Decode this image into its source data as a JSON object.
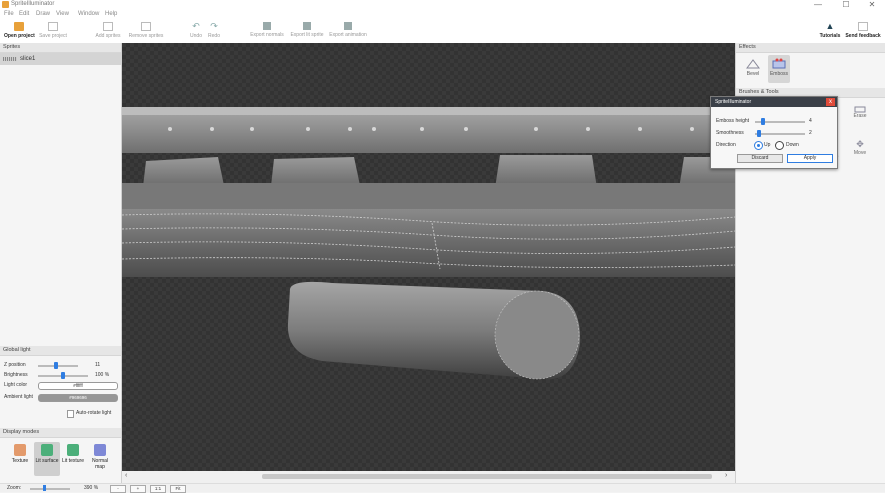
{
  "app": {
    "title": "SpriteIlluminator"
  },
  "window_controls": {
    "minimize": "—",
    "maximize": "☐",
    "close": "✕"
  },
  "menu": [
    "File",
    "Edit",
    "Draw",
    "View",
    "Window",
    "Help"
  ],
  "toolbar": {
    "open_project": "Open project",
    "save_project": "Save project",
    "add_sprites": "Add sprites",
    "remove_sprites": "Remove sprites",
    "undo": "Undo",
    "redo": "Redo",
    "export_normals": "Export normals",
    "export_lit_sprite": "Export lit sprite",
    "export_animation": "Export animation",
    "tutorials": "Tutorials",
    "send_feedback": "Send feedback"
  },
  "sprites_panel": {
    "header": "Sprites",
    "items": [
      {
        "name": "slice1"
      }
    ]
  },
  "global_light": {
    "header": "Global light",
    "z_position_label": "Z position",
    "z_position_value": "11",
    "z_position_level": 0.45,
    "brightness_label": "Brightness",
    "brightness_value": "100 %",
    "brightness_level": 0.5,
    "light_color_label": "Light color",
    "light_color_value": "#ffffff",
    "ambient_light_label": "Ambient light",
    "ambient_light_value": "#969696",
    "auto_rotate_label": "Auto-rotate light"
  },
  "display_modes": {
    "header": "Display modes",
    "items": [
      {
        "label": "Texture",
        "color": "#e39a6b"
      },
      {
        "label": "Lit surface",
        "color": "#4caf7a",
        "selected": true
      },
      {
        "label": "Lit texture",
        "color": "#4caf7a"
      },
      {
        "label": "Normal map",
        "color": "#7e88d6"
      }
    ]
  },
  "effects": {
    "header": "Effects",
    "items": [
      {
        "label": "Bevel"
      },
      {
        "label": "Emboss",
        "selected": true
      }
    ]
  },
  "brushes": {
    "header": "Brushes & Tools",
    "partial_labels": [
      "ten",
      "Erase",
      "e",
      "Move"
    ]
  },
  "dialog": {
    "title": "SpriteIlluminator",
    "close": "x",
    "emboss_height_label": "Emboss height",
    "emboss_height_value": "4",
    "emboss_height_level": 0.15,
    "smoothness_label": "Smoothness",
    "smoothness_value": "2",
    "smoothness_level": 0.08,
    "direction_label": "Direction",
    "direction_up": "Up",
    "direction_down": "Down",
    "direction_selected": "Up",
    "discard": "Discard",
    "apply": "Apply"
  },
  "status": {
    "zoom_label": "Zoom:",
    "zoom_value": "390 %",
    "zoom_out": "-",
    "zoom_in": "+",
    "one_to_one": "1:1",
    "fit": "Fit"
  },
  "colors": {
    "accent": "#2f7de1",
    "dialog_title_bg": "#3b4048",
    "close_red": "#e04b3a"
  }
}
